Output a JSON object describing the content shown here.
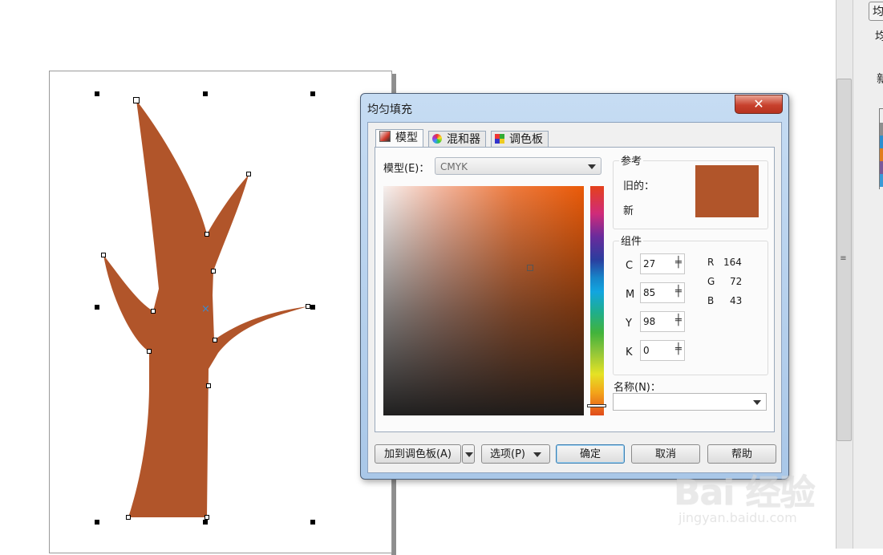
{
  "dialog": {
    "title": "均匀填充",
    "close_glyph": "✕",
    "tabs": [
      {
        "label": "模型",
        "icon": "model-icon"
      },
      {
        "label": "混和器",
        "icon": "mixer-icon"
      },
      {
        "label": "调色板",
        "icon": "palette-icon"
      }
    ],
    "model_label": "模型(E)：",
    "model_value": "CMYK",
    "reference": {
      "title": "参考",
      "old_label": "旧的：",
      "new_label": "新",
      "old_color": "#b1552a"
    },
    "components": {
      "title": "组件",
      "cmyk": [
        {
          "label": "C",
          "value": "27"
        },
        {
          "label": "M",
          "value": "85"
        },
        {
          "label": "Y",
          "value": "98"
        },
        {
          "label": "K",
          "value": "0"
        }
      ],
      "rgb": [
        {
          "label": "R",
          "value": "164"
        },
        {
          "label": "G",
          "value": "72"
        },
        {
          "label": "B",
          "value": "43"
        }
      ]
    },
    "name_label": "名称(N)：",
    "name_value": "",
    "buttons": {
      "add_to_palette": "加到调色板(A)",
      "options": "选项(P)",
      "ok": "确定",
      "cancel": "取消",
      "help": "帮助"
    }
  },
  "right_panel": {
    "top_char": "均",
    "char2": "均",
    "char3": "新"
  },
  "shape_color": "#b1552a",
  "watermark": {
    "brand": "Bai 经验",
    "url": "jingyan.baidu.com"
  }
}
